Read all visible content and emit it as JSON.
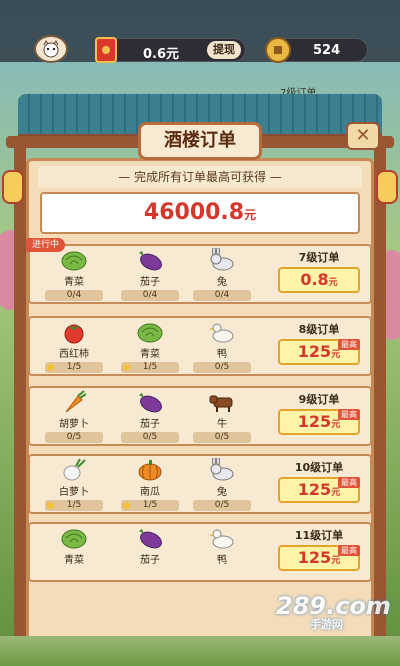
{
  "topbar": {
    "money": "0.6元",
    "withdraw_label": "提现",
    "coins": "524",
    "background_order_hint": "7级订单"
  },
  "dialog": {
    "title": "酒楼订单",
    "close_icon": "close-icon",
    "reward_heading": "完成所有订单最高可获得",
    "reward_value": "46000.8",
    "reward_unit": "元"
  },
  "orders": [
    {
      "tag": "进行中",
      "level": "7级订单",
      "prize_value": "0.8",
      "prize_unit": "元",
      "prize_badge": "",
      "items": [
        {
          "name": "青菜",
          "icon": "cabbage-icon",
          "progress": "0/4"
        },
        {
          "name": "茄子",
          "icon": "eggplant-icon",
          "progress": "0/4"
        },
        {
          "name": "兔",
          "icon": "rabbit-icon",
          "progress": "0/4"
        }
      ]
    },
    {
      "tag": "",
      "level": "8级订单",
      "prize_value": "125",
      "prize_unit": "元",
      "prize_badge": "最高",
      "items": [
        {
          "name": "西红柿",
          "icon": "tomato-icon",
          "progress": "1/5"
        },
        {
          "name": "青菜",
          "icon": "cabbage-icon",
          "progress": "1/5"
        },
        {
          "name": "鸭",
          "icon": "duck-icon",
          "progress": "0/5"
        }
      ]
    },
    {
      "tag": "",
      "level": "9级订单",
      "prize_value": "125",
      "prize_unit": "元",
      "prize_badge": "最高",
      "items": [
        {
          "name": "胡萝卜",
          "icon": "carrot-icon",
          "progress": "0/5"
        },
        {
          "name": "茄子",
          "icon": "eggplant-icon",
          "progress": "0/5"
        },
        {
          "name": "牛",
          "icon": "cow-icon",
          "progress": "0/5"
        }
      ]
    },
    {
      "tag": "",
      "level": "10级订单",
      "prize_value": "125",
      "prize_unit": "元",
      "prize_badge": "最高",
      "items": [
        {
          "name": "白萝卜",
          "icon": "radish-icon",
          "progress": "1/5"
        },
        {
          "name": "南瓜",
          "icon": "pumpkin-icon",
          "progress": "1/5"
        },
        {
          "name": "兔",
          "icon": "rabbit-icon",
          "progress": "0/5"
        }
      ]
    },
    {
      "tag": "",
      "level": "11级订单",
      "prize_value": "125",
      "prize_unit": "元",
      "prize_badge": "最高",
      "items": [
        {
          "name": "青菜",
          "icon": "cabbage-icon",
          "progress": ""
        },
        {
          "name": "茄子",
          "icon": "eggplant-icon",
          "progress": ""
        },
        {
          "name": "鸭",
          "icon": "duck-icon",
          "progress": ""
        }
      ]
    }
  ],
  "watermark": {
    "text": "289.com",
    "sub": "手游网"
  },
  "colors": {
    "accent_red": "#d6362b",
    "panel_bg": "#f4dcb8",
    "frame_brown": "#9a5532",
    "roof_teal": "#3b7f91",
    "prize_yellow": "#fff4a8"
  }
}
